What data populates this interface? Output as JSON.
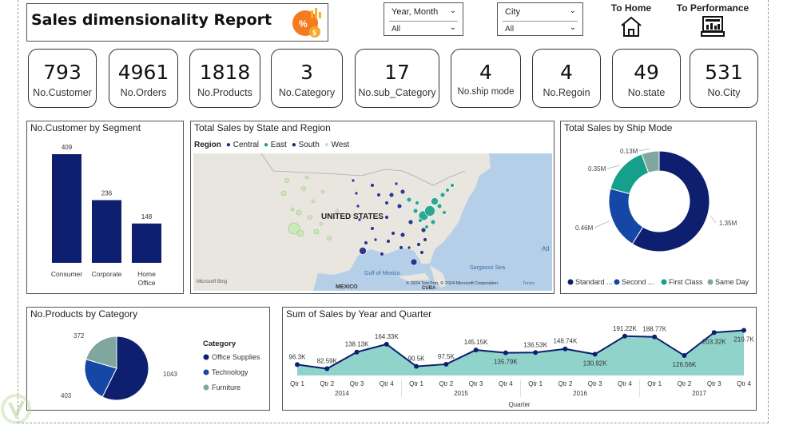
{
  "header": {
    "title": "Sales dimensionality Report",
    "logo_icon": "sales-percent-logo-icon"
  },
  "slicers": [
    {
      "label": "Year, Month",
      "value": "All"
    },
    {
      "label": "City",
      "value": "All"
    }
  ],
  "nav": {
    "home_label": "To Home",
    "performance_label": "To Performance"
  },
  "kpis": [
    {
      "value": "793",
      "label": "No.Customer"
    },
    {
      "value": "4961",
      "label": "No.Orders"
    },
    {
      "value": "1818",
      "label": "No.Products"
    },
    {
      "value": "3",
      "label": "No.Category"
    },
    {
      "value": "17",
      "label": "No.sub_Category"
    },
    {
      "value": "4",
      "label": "No.ship mode"
    },
    {
      "value": "4",
      "label": "No.Regoin"
    },
    {
      "value": "49",
      "label": "No.state"
    },
    {
      "value": "531",
      "label": "No.City"
    }
  ],
  "map_panel": {
    "title": "Total Sales by State and Region",
    "legend_title": "Region",
    "legend": [
      {
        "name": "Central",
        "color": "#1a2a8c"
      },
      {
        "name": "East",
        "color": "#16a08c"
      },
      {
        "name": "South",
        "color": "#1a237e"
      },
      {
        "name": "West",
        "color": "#c5e8b0"
      }
    ],
    "country_label": "UNITED STATES",
    "gulf_label": "Gulf of Mexico",
    "mexico_label": "MEXICO",
    "cuba_label": "CUBA",
    "sargasso_label": "Sargasso Sea",
    "atl_label": "Atl",
    "brand": "Microsoft Bing",
    "attribution": "© 2024 TomTom, © 2024 Microsoft Corporation",
    "terms": "Terms"
  },
  "chart_data": [
    {
      "type": "bar",
      "title": "No.Customer by Segment",
      "categories": [
        "Consumer",
        "Corporate",
        "Home Office"
      ],
      "values": [
        409,
        236,
        148
      ],
      "color": "#0d1f6e"
    },
    {
      "type": "pie",
      "title": "Total Sales by Ship Mode",
      "donut": true,
      "slices": [
        {
          "name": "Standard ...",
          "value": 1.35,
          "label": "1.35M",
          "color": "#0d1f6e"
        },
        {
          "name": "Second ...",
          "value": 0.46,
          "label": "0.46M",
          "color": "#1747a6"
        },
        {
          "name": "First Class",
          "value": 0.35,
          "label": "0.35M",
          "color": "#16a08c"
        },
        {
          "name": "Same Day",
          "value": 0.13,
          "label": "0.13M",
          "color": "#7fa7a0"
        }
      ]
    },
    {
      "type": "pie",
      "title": "No.Products by Category",
      "legend_title": "Category",
      "slices": [
        {
          "name": "Office Supplies",
          "value": 1043,
          "label": "1043",
          "color": "#0d1f6e"
        },
        {
          "name": "Technology",
          "value": 403,
          "label": "403",
          "color": "#1747a6"
        },
        {
          "name": "Furniture",
          "value": 372,
          "label": "372",
          "color": "#7fa7a0"
        }
      ]
    },
    {
      "type": "area",
      "title": "Sum of Sales by Year and Quarter",
      "xlabel": "Quarter",
      "years": [
        "2014",
        "2015",
        "2016",
        "2017"
      ],
      "quarters": [
        "Qtr 1",
        "Qtr 2",
        "Qtr 3",
        "Qtr 4"
      ],
      "values": [
        96.3,
        82.59,
        138.13,
        164.33,
        90.5,
        97.5,
        145.15,
        135.79,
        136.53,
        148.74,
        130.92,
        191.22,
        188.77,
        126.56,
        203.32,
        210.7
      ],
      "labels": [
        "96.3K",
        "82.59K",
        "138.13K",
        "164.33K",
        "90.5K",
        "97.5K",
        "145.15K",
        "135.79K",
        "136.53K",
        "148.74K",
        "130.92K",
        "191.22K",
        "188.77K",
        "126.56K",
        "203.32K",
        "210.7K"
      ],
      "line_color": "#0d1f6e",
      "fill_color": "#8fd3cb"
    }
  ]
}
